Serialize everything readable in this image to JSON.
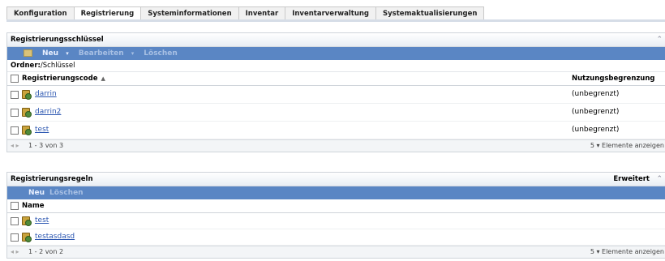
{
  "tabs": [
    "Konfiguration",
    "Registrierung",
    "Systeminformationen",
    "Inventar",
    "Inventarverwaltung",
    "Systemaktualisierungen"
  ],
  "active_tab": "Registrierung",
  "keys_panel": {
    "title": "Registrierungsschlüssel",
    "toolbar": {
      "new": "Neu",
      "edit": "Bearbeiten",
      "delete": "Löschen"
    },
    "folder_label": "Ordner:",
    "folder_path": "/Schlüssel",
    "columns": {
      "code": "Registrierungscode",
      "limit": "Nutzungsbegrenzung"
    },
    "rows": [
      {
        "name": "darrin",
        "limit": "(unbegrenzt)"
      },
      {
        "name": "darrin2",
        "limit": "(unbegrenzt)"
      },
      {
        "name": "test",
        "limit": "(unbegrenzt)"
      }
    ],
    "pager": {
      "range": "1 - 3 von 3",
      "show": "5 ▾ Elemente anzeigen"
    }
  },
  "rules_panel": {
    "title": "Registrierungsregeln",
    "advanced": "Erweitert",
    "toolbar": {
      "new": "Neu",
      "delete": "Löschen"
    },
    "columns": {
      "name": "Name"
    },
    "rows": [
      {
        "name": "test"
      },
      {
        "name": "testasdasd"
      }
    ],
    "pager": {
      "range": "1 - 2 von 2",
      "show": "5 ▾ Elemente anzeigen"
    }
  },
  "icons": {
    "collapse": "double-chevron-up-icon",
    "folder": "folder-icon",
    "key": "registration-key-icon",
    "checkbox": "checkbox-icon"
  }
}
